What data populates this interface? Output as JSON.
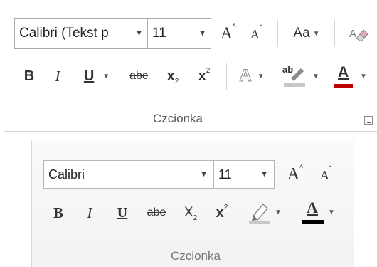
{
  "top_group": {
    "font_name": "Calibri (Tekst p",
    "font_size": "11",
    "grow_font": "A",
    "shrink_font": "A",
    "change_case": "Aa",
    "bold": "B",
    "italic": "I",
    "underline": "U",
    "strikethrough": "abc",
    "subscript": "x",
    "subscript_small": "2",
    "superscript": "x",
    "superscript_small": "2",
    "text_effects": "A",
    "highlight": "ab",
    "font_color": "A",
    "label": "Czcionka"
  },
  "bottom_group": {
    "font_name": "Calibri",
    "font_size": "11",
    "grow_font": "A",
    "shrink_font": "A",
    "bold": "B",
    "italic": "I",
    "underline": "U",
    "strikethrough": "abe",
    "subscript": "X",
    "subscript_small": "2",
    "superscript": "x",
    "superscript_small": "2",
    "font_color": "A",
    "label": "Czcionka"
  },
  "colors": {
    "font_color_bar_top": "#c00000",
    "font_color_bar_bottom": "#000000",
    "highlight_bar": "#c8c8c8"
  }
}
